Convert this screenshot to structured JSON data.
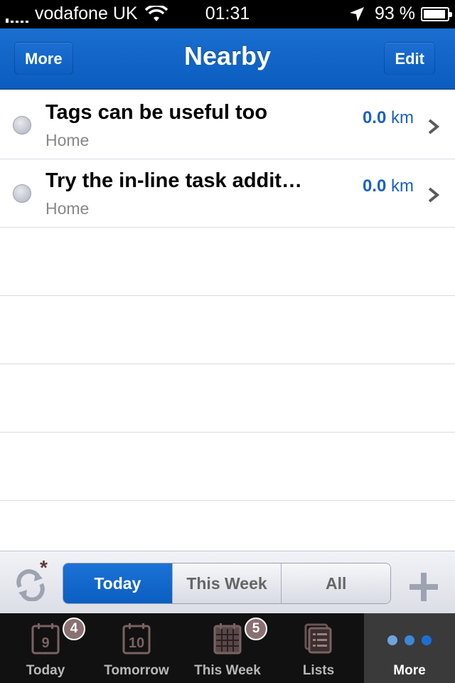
{
  "status_bar": {
    "carrier": "vodafone UK",
    "time": "01:31",
    "battery": "93 %"
  },
  "nav": {
    "left_button": "More",
    "title": "Nearby",
    "right_button": "Edit"
  },
  "tasks": [
    {
      "title": "Tags can be useful too",
      "list": "Home",
      "distance": "0.0",
      "unit": "km"
    },
    {
      "title": "Try the in-line task addit…",
      "list": "Home",
      "distance": "0.0",
      "unit": "km"
    }
  ],
  "filter": {
    "segments": [
      "Today",
      "This Week",
      "All"
    ],
    "selected": "Today"
  },
  "tabs": [
    {
      "label": "Today",
      "icon": "calendar-day-icon",
      "day": "9",
      "badge": "4"
    },
    {
      "label": "Tomorrow",
      "icon": "calendar-day-icon",
      "day": "10"
    },
    {
      "label": "This Week",
      "icon": "calendar-week-icon",
      "badge": "5"
    },
    {
      "label": "Lists",
      "icon": "lists-icon"
    },
    {
      "label": "More",
      "icon": "more-dots-icon",
      "active": true
    }
  ],
  "colors": {
    "accent": "#0b5ec2",
    "distance": "#1962c0",
    "badge": "#8a7070"
  }
}
